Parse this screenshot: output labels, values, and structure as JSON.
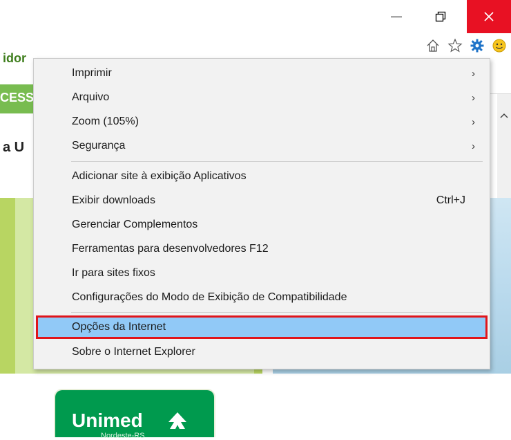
{
  "window": {
    "controls": {
      "minimize": "—",
      "maximize": "⧉",
      "close": "✕"
    }
  },
  "toolbar": {
    "icons": [
      "home-icon",
      "favorites-star-icon",
      "tools-gear-icon",
      "smiley-feedback-icon"
    ],
    "accent": "#1e73c8"
  },
  "page": {
    "text1": "idor",
    "strip_text": "CESS",
    "text2": "a U",
    "logo_text": "Unimed",
    "logo_sub": "Nordeste-RS"
  },
  "menu": {
    "items": [
      {
        "label": "Imprimir",
        "submenu": true
      },
      {
        "label": "Arquivo",
        "submenu": true
      },
      {
        "label": "Zoom (105%)",
        "submenu": true
      },
      {
        "label": "Segurança",
        "submenu": true
      },
      {
        "label": "Adicionar site à exibição Aplicativos"
      },
      {
        "label": "Exibir downloads",
        "shortcut": "Ctrl+J"
      },
      {
        "label": "Gerenciar Complementos"
      },
      {
        "label": "Ferramentas para desenvolvedores F12"
      },
      {
        "label": "Ir para sites fixos"
      },
      {
        "label": "Configurações do Modo de Exibição de Compatibilidade"
      },
      {
        "label": "Opções da Internet",
        "highlighted": true
      },
      {
        "label": "Sobre o Internet Explorer"
      }
    ],
    "submenu_arrow": "›",
    "highlight_color": "#91c9f7",
    "highlight_border": "#e0151b"
  }
}
